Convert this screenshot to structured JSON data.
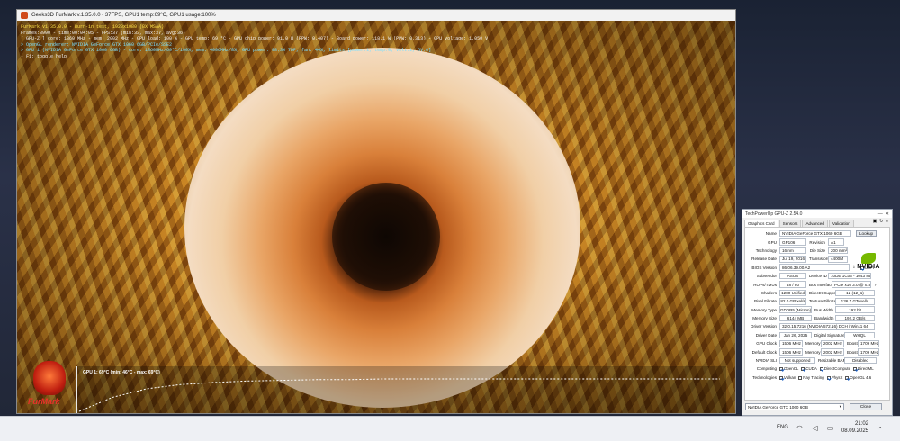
{
  "furmark": {
    "title": "Geeks3D FurMark v.1.35.0.0 - 37FPS, GPU1 temp:69°C, GPU1 usage:100%",
    "overlay": [
      {
        "text": "FurMark v1.35.0.0 - Burn-in test, 1920x1080 (8X MSAA)",
        "color": "yellow"
      },
      {
        "text": "Frames:8990 - time:00:04:05 - FPS:37 (min:33, max:37, avg:36)",
        "color": "white"
      },
      {
        "text": "[ GPU-Z ] core: 1860 MHz - mem: 2002 MHz - GPU load: 100 % - GPU temp: 69 °C - GPU chip power: 91.0 W (PPW: 0.407) - Board power: 118.1 W (PPW: 0.313) - GPU voltage: 1.050 V",
        "color": "white"
      },
      {
        "text": "> OpenGL renderer: NVIDIA GeForce GTX 1060 6GB/PCIe/SSE2",
        "color": "cyan"
      },
      {
        "text": "> GPU 1 (NVIDIA GeForce GTX 1060 6GB) - core: 1860MHz/69°C/100%, mem: 4006MHz/8%, GPU power: 98.3% TDP, fan: 44%, limits:[power:1, temp:0, volt:1, OV:0]",
        "color": "cyan"
      },
      {
        "text": "- F1: toggle help",
        "color": "white"
      }
    ],
    "graph_label": "GPU 1: 69°C (min: 46°C - max: 69°C)",
    "logo_text": "FurMark",
    "temp_series": {
      "min": 46,
      "max": 69,
      "values": [
        46,
        56,
        62,
        65,
        66.5,
        67.5,
        68,
        68.5,
        68.5,
        69,
        69,
        69,
        69,
        69,
        69,
        69,
        69,
        69,
        69,
        69
      ]
    }
  },
  "gpuz": {
    "title": "TechPowerUp GPU-Z 2.54.0",
    "tabs": [
      "Graphics Card",
      "Sensors",
      "Advanced",
      "Validation"
    ],
    "lookup_label": "Lookup",
    "name_label": "Name",
    "name": "NVIDIA GeForce GTX 1060 6GB",
    "gpu_label": "GPU",
    "gpu": "GP106",
    "revision_label": "Revision",
    "revision": "A1",
    "technology_label": "Technology",
    "technology": "16 nm",
    "die_size_label": "Die Size",
    "die_size": "200 mm²",
    "release_date_label": "Release Date",
    "release_date": "Jul 19, 2016",
    "transistors_label": "Transistors",
    "transistors": "4400M",
    "bios_label": "BIOS Version",
    "bios": "86.06.39.00.A2",
    "uefi_label": "UEFI",
    "subvendor_label": "Subvendor",
    "subvendor": "ASUS",
    "device_id_label": "Device ID",
    "device_id": "10DE 1C03 - 1043 85E1",
    "rops_label": "ROPs/TMUs",
    "rops": "48 / 80",
    "bus_interface_label": "Bus Interface",
    "bus_interface": "PCIe x16 3.0 @ x16 3.0",
    "shaders_label": "Shaders",
    "shaders": "1280 Unified",
    "directx_label": "DirectX Support",
    "directx": "12 (12_1)",
    "pixel_fillrate_label": "Pixel Fillrate",
    "pixel_fillrate": "82.0 GPixel/s",
    "texture_fillrate_label": "Texture Fillrate",
    "texture_fillrate": "136.7 GTexel/s",
    "memory_type_label": "Memory Type",
    "memory_type": "GDDR5 (Micron)",
    "bus_width_label": "Bus Width",
    "bus_width": "192 bit",
    "memory_size_label": "Memory Size",
    "memory_size": "6144 MB",
    "bandwidth_label": "Bandwidth",
    "bandwidth": "192.2 GB/s",
    "driver_version_label": "Driver Version",
    "driver_version": "32.0.15.7216 (NVIDIA 572.16) DCH / Win11 64",
    "driver_date_label": "Driver Date",
    "driver_date": "Jan 26, 2025",
    "digital_signature_label": "Digital Signature",
    "digital_signature": "WHQL",
    "gpu_clock_label": "GPU Clock",
    "gpu_clock": "1506 MHz",
    "memory_label": "Memory",
    "memory_clock": "2002 MHz",
    "boost_label": "Boost",
    "boost_clock": "1709 MHz",
    "default_clock_label": "Default Clock",
    "default_clock": "1506 MHz",
    "default_memory": "2002 MHz",
    "default_boost": "1709 MHz",
    "sli_label": "NVIDIA SLI",
    "sli": "Not supported",
    "resizable_bar_label": "Resizable BAR",
    "resizable_bar": "Disabled",
    "computing_label": "Computing",
    "computing": [
      {
        "name": "OpenCL",
        "on": true
      },
      {
        "name": "CUDA",
        "on": true
      },
      {
        "name": "DirectCompute",
        "on": true
      },
      {
        "name": "DirectML",
        "on": true
      }
    ],
    "technologies_label": "Technologies",
    "technologies": [
      {
        "name": "Vulkan",
        "on": true
      },
      {
        "name": "Ray Tracing",
        "on": false
      },
      {
        "name": "PhysX",
        "on": true
      },
      {
        "name": "OpenGL 4.6",
        "on": true
      }
    ],
    "selected_gpu": "NVIDIA GeForce GTX 1060 6GB",
    "close_label": "Close",
    "nvidia_text": "NVIDIA"
  },
  "taskbar": {
    "language": "ENG",
    "time": "21:02",
    "date": "08.09.2025"
  }
}
